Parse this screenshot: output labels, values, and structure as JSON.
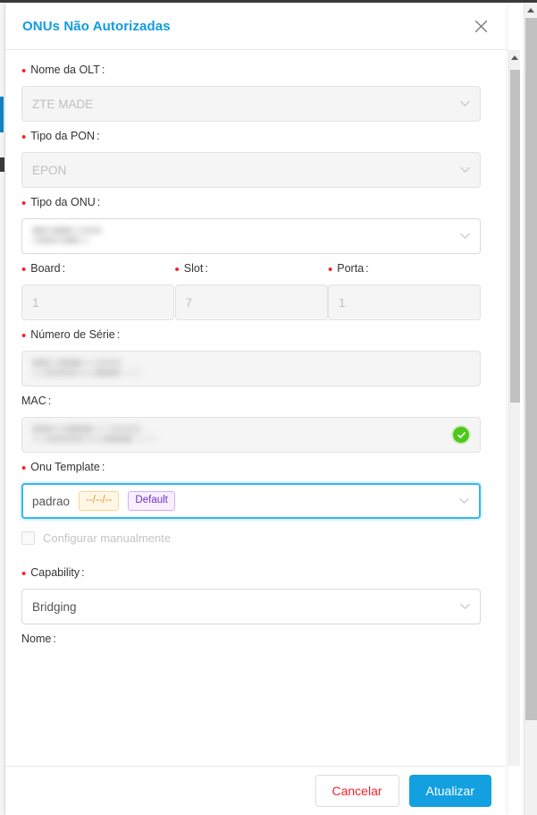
{
  "window": {
    "close_icon": "close-x-icon"
  },
  "modal": {
    "title": "ONUs Não Autorizadas",
    "fields": [
      {
        "key": "nome_olt",
        "label": "Nome da OLT",
        "required": true,
        "colon": ":",
        "control": "select",
        "value": "ZTE MADE",
        "disabled": true,
        "redacted": false
      },
      {
        "key": "tipo_pon",
        "label": "Tipo da PON",
        "required": true,
        "colon": ":",
        "control": "select",
        "value": "EPON",
        "disabled": true,
        "redacted": false
      },
      {
        "key": "tipo_onu",
        "label": "Tipo da ONU",
        "required": true,
        "colon": ":",
        "control": "select",
        "value": "",
        "disabled": false,
        "redacted": true
      },
      {
        "key": "board",
        "label": "Board",
        "required": true,
        "colon": ":",
        "control": "input",
        "value": "1",
        "disabled": true,
        "redacted": false
      },
      {
        "key": "slot",
        "label": "Slot",
        "required": true,
        "colon": ":",
        "control": "input",
        "value": "7",
        "disabled": true,
        "redacted": false
      },
      {
        "key": "porta",
        "label": "Porta",
        "required": true,
        "colon": ":",
        "control": "input",
        "value": "1",
        "disabled": true,
        "redacted": false
      },
      {
        "key": "numero_serie",
        "label": "Número de Série",
        "required": true,
        "colon": ":",
        "control": "input",
        "value": "",
        "disabled": true,
        "redacted": true
      },
      {
        "key": "mac",
        "label": "MAC",
        "required": false,
        "colon": ":",
        "control": "input",
        "value": "",
        "disabled": true,
        "redacted": true,
        "status_icon": "green-check-icon"
      },
      {
        "key": "onu_template",
        "label": "Onu Template",
        "required": true,
        "colon": ":",
        "control": "select",
        "value": "padrao",
        "disabled": false,
        "focused": true,
        "tags": [
          {
            "text": "--/--/--",
            "style": "orange"
          },
          {
            "text": "Default",
            "style": "purple"
          }
        ]
      },
      {
        "key": "capability",
        "label": "Capability",
        "required": true,
        "colon": ":",
        "control": "select",
        "value": "Bridging",
        "disabled": false,
        "redacted": false
      },
      {
        "key": "nome",
        "label": "Nome",
        "required": false,
        "colon": ":",
        "control": "input",
        "value": "",
        "clipped": true
      }
    ],
    "checkbox": {
      "label": "Configurar manualmente",
      "checked": false,
      "disabled": true
    },
    "footer": {
      "cancel_label": "Cancelar",
      "submit_label": "Atualizar"
    }
  },
  "colors": {
    "title_blue": "#0f9ce0",
    "primary_button": "#12a0e0",
    "cancel_text": "#f5222d",
    "required_dot": "#f5222d",
    "focus_border": "#36b6f0",
    "success_green": "#4fc71c",
    "tag_orange_text": "#fa8c16",
    "tag_orange_bg": "#fff7e6",
    "tag_purple_text": "#722ed1",
    "tag_purple_bg": "#f9f0ff"
  },
  "scrollbars": {
    "inner": {
      "name": "modal-scrollbar"
    },
    "outer": {
      "name": "page-scrollbar"
    }
  }
}
